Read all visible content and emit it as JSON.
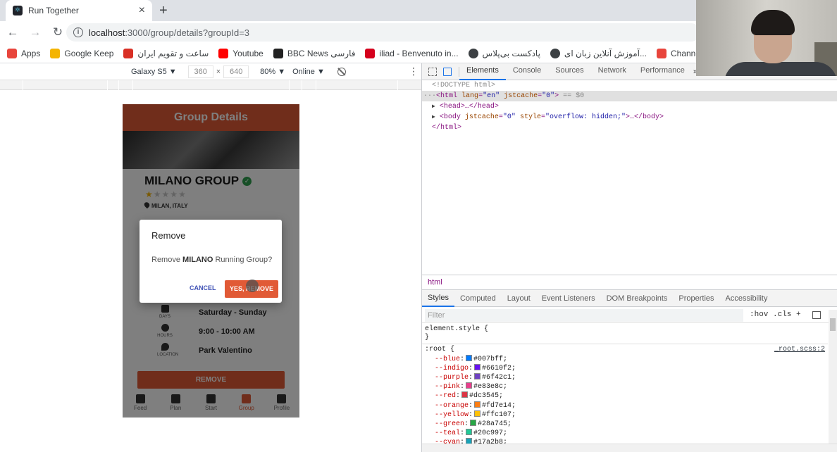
{
  "browser": {
    "tab_title": "Run Together",
    "tab_close": "×",
    "new_tab": "+",
    "url_host": "localhost",
    "url_path": ":3000/group/details?groupId=3",
    "nav": {
      "back": "←",
      "forward": "→",
      "reload": "↻"
    },
    "bookmarks": [
      {
        "label": "Apps",
        "icon": "apps-grid-icon"
      },
      {
        "label": "Google Keep",
        "icon": "google-keep-icon"
      },
      {
        "label": "ساعت و تقویم ایران",
        "icon": "checkbox-icon"
      },
      {
        "label": "Youtube",
        "icon": "youtube-icon"
      },
      {
        "label": "BBC News فارسی",
        "icon": "bbc-icon"
      },
      {
        "label": "iliad - Benvenuto in...",
        "icon": "iliad-icon"
      },
      {
        "label": "پادکست بی‌پلاس",
        "icon": "globe-icon"
      },
      {
        "label": "آموزش آنلاین زبان ای...",
        "icon": "globe-icon"
      },
      {
        "label": "Channel B Podcast...",
        "icon": "channel-b-icon"
      }
    ]
  },
  "device_toolbar": {
    "device": "Galaxy S5 ▼",
    "width": "360",
    "times": "×",
    "height": "640",
    "zoom": "80% ▼",
    "network": "Online ▼"
  },
  "app": {
    "header_title": "Group Details",
    "group_name": "MILANO GROUP",
    "verified_mark": "✓",
    "rating": 1,
    "max_rating": 5,
    "location": "MILAN, ITALY",
    "schedule": [
      {
        "icon": "calendar-icon",
        "label": "DAYS",
        "value": "Saturday - Sunday"
      },
      {
        "icon": "clock-icon",
        "label": "HOURS",
        "value": "9:00 - 10:00 AM"
      },
      {
        "icon": "location-pin-icon",
        "label": "LOCATION",
        "value": "Park Valentino"
      }
    ],
    "remove_button": "REMOVE",
    "bottom_nav": [
      {
        "label": "Feed",
        "icon": "feed-icon",
        "active": false
      },
      {
        "label": "Plan",
        "icon": "plan-icon",
        "active": false
      },
      {
        "label": "Start",
        "icon": "stopwatch-icon",
        "active": false
      },
      {
        "label": "Group",
        "icon": "group-icon",
        "active": true
      },
      {
        "label": "Profile",
        "icon": "profile-icon",
        "active": false
      }
    ],
    "dialog": {
      "title": "Remove",
      "message_prefix": "Remove ",
      "message_bold": "MILANO",
      "message_suffix": " Running Group?",
      "cancel": "CANCEL",
      "confirm": "YES, REMOVE"
    }
  },
  "devtools": {
    "tabs": [
      "Elements",
      "Console",
      "Sources",
      "Network",
      "Performance"
    ],
    "selected_tab": "Elements",
    "more": "»",
    "dom": {
      "doctype": "<!DOCTYPE html>",
      "html_open_tag": "<html",
      "html_attr1_name": "lang",
      "html_attr1_value": "\"en\"",
      "html_attr2_name": "jstcache",
      "html_attr2_value": "\"0\"",
      "html_open_end": ">",
      "selected_marker": " == $0",
      "head_line": "<head>…</head>",
      "body_open": "<body",
      "body_attr1_name": "jstcache",
      "body_attr1_value": "\"0\"",
      "body_attr2_name": "style",
      "body_attr2_value": "\"overflow: hidden;\"",
      "body_close": ">…</body>",
      "html_close": "</html>"
    },
    "breadcrumb": "html",
    "styles_tabs": [
      "Styles",
      "Computed",
      "Layout",
      "Event Listeners",
      "DOM Breakpoints",
      "Properties",
      "Accessibility"
    ],
    "filter_placeholder": "Filter",
    "filter_tools": ":hov  .cls  +",
    "element_style_open": "element.style {",
    "element_style_close": "}",
    "root_selector": ":root {",
    "root_source": "_root.scss:2",
    "css_vars": [
      {
        "name": "--blue",
        "value": "#007bff"
      },
      {
        "name": "--indigo",
        "value": "#6610f2"
      },
      {
        "name": "--purple",
        "value": "#6f42c1"
      },
      {
        "name": "--pink",
        "value": "#e83e8c"
      },
      {
        "name": "--red",
        "value": "#dc3545"
      },
      {
        "name": "--orange",
        "value": "#fd7e14"
      },
      {
        "name": "--yellow",
        "value": "#ffc107"
      },
      {
        "name": "--green",
        "value": "#28a745"
      },
      {
        "name": "--teal",
        "value": "#20c997"
      },
      {
        "name": "--cyan",
        "value": "#17a2b8"
      }
    ]
  },
  "colors": {
    "app_accent": "#e15a36",
    "dialog_cancel": "#3f51b5",
    "verified": "#2e9e4f"
  }
}
